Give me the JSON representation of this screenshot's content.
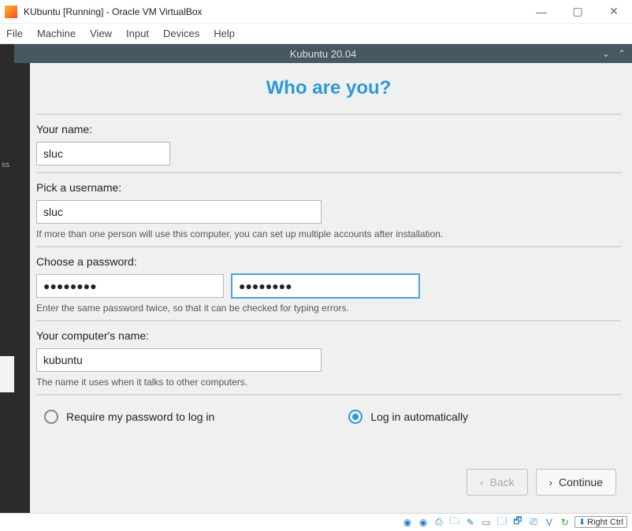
{
  "host": {
    "title": "KUbuntu [Running] - Oracle VM VirtualBox",
    "menu": {
      "file": "File",
      "machine": "Machine",
      "view": "View",
      "input": "Input",
      "devices": "Devices",
      "help": "Help"
    },
    "controls": {
      "min": "—",
      "max": "▢",
      "close": "✕"
    }
  },
  "vm": {
    "header_title": "Kubuntu 20.04",
    "chev_down": "⌄",
    "chev_up": "⌃",
    "left_ss": "ss"
  },
  "installer": {
    "heading": "Who are you?",
    "name": {
      "label": "Your name:",
      "value": "sluc"
    },
    "username": {
      "label": "Pick a username:",
      "value": "sluc",
      "hint": "If more than one person will use this computer, you can set up multiple accounts after installation."
    },
    "password": {
      "label": "Choose a password:",
      "value1": "●●●●●●●●",
      "value2": "●●●●●●●●",
      "hint": "Enter the same password twice, so that it can be checked for typing errors."
    },
    "computer_name": {
      "label": "Your computer's name:",
      "value": "kubuntu",
      "hint": "The name it uses when it talks to other computers."
    },
    "login_options": {
      "require": "Require my password to log in",
      "auto": "Log in automatically",
      "selected": "auto"
    },
    "buttons": {
      "back": "Back",
      "continue": "Continue",
      "back_chev": "‹",
      "cont_chev": "›"
    }
  },
  "statusbar": {
    "hostkey_label": "Right Ctrl",
    "arrow": "⬇"
  }
}
